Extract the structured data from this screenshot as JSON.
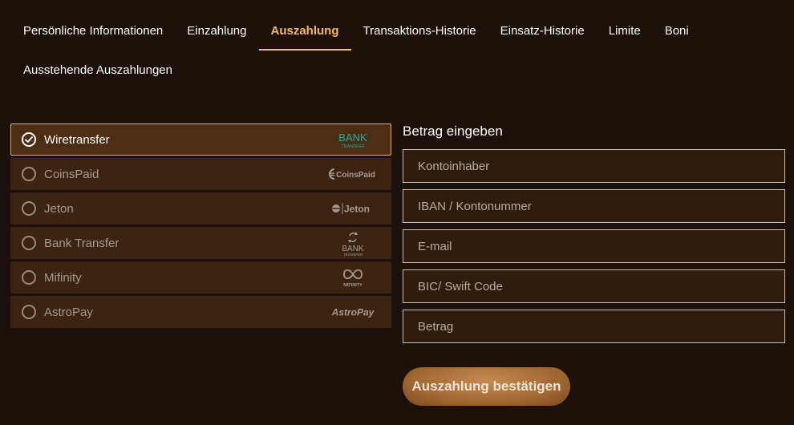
{
  "tabs": [
    {
      "label": "Persönliche Informationen",
      "active": false
    },
    {
      "label": "Einzahlung",
      "active": false
    },
    {
      "label": "Auszahlung",
      "active": true
    },
    {
      "label": "Transaktions-Historie",
      "active": false
    },
    {
      "label": "Einsatz-Historie",
      "active": false
    },
    {
      "label": "Limite",
      "active": false
    },
    {
      "label": "Boni",
      "active": false
    },
    {
      "label": "Ausstehende Auszahlungen",
      "active": false
    }
  ],
  "methods": [
    {
      "label": "Wiretransfer",
      "selected": true,
      "logo_icon": "bank-transfer-logo",
      "logo_text": [
        "BANK",
        "TRANSFER"
      ]
    },
    {
      "label": "CoinsPaid",
      "selected": false,
      "logo_icon": "coinspaid-logo",
      "logo_text": [
        "CoinsPaid"
      ]
    },
    {
      "label": "Jeton",
      "selected": false,
      "logo_icon": "jeton-logo",
      "logo_text": [
        "Jeton"
      ]
    },
    {
      "label": "Bank Transfer",
      "selected": false,
      "logo_icon": "bank-transfer-logo",
      "logo_text": [
        "BANK",
        "TRANSFER"
      ]
    },
    {
      "label": "Mifinity",
      "selected": false,
      "logo_icon": "mifinity-logo",
      "logo_text": [
        "MIFINITY"
      ]
    },
    {
      "label": "AstroPay",
      "selected": false,
      "logo_icon": "astropay-logo",
      "logo_text": [
        "AstroPay"
      ]
    }
  ],
  "form": {
    "title": "Betrag eingeben",
    "fields": [
      {
        "placeholder": "Kontoinhaber",
        "value": ""
      },
      {
        "placeholder": "IBAN / Kontonummer",
        "value": ""
      },
      {
        "placeholder": "E-mail",
        "value": ""
      },
      {
        "placeholder": "BIC/ Swift Code",
        "value": ""
      },
      {
        "placeholder": "Betrag",
        "value": ""
      }
    ],
    "submit_label": "Auszahlung bestätigen"
  },
  "colors": {
    "background": "#1b110a",
    "accent": "#f6bc5e",
    "method_bg": "#3b2412",
    "selected_border": "#e3b256",
    "field_border": "#cdbfb2",
    "bank_logo_teal": "#1fa99a"
  }
}
